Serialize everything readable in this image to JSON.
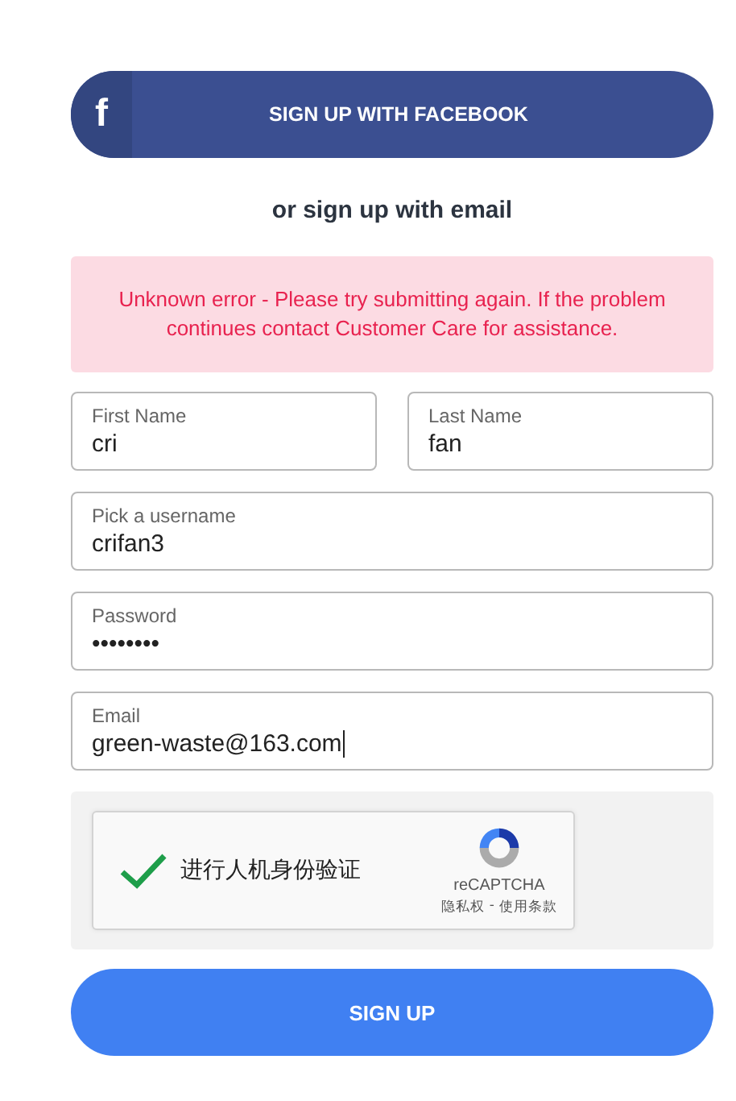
{
  "facebook_button": {
    "icon_letter": "f",
    "label": "SIGN UP WITH FACEBOOK"
  },
  "divider_text": "or sign up with email",
  "error_message": "Unknown error - Please try submitting again. If the problem continues contact Customer Care for assistance.",
  "fields": [
    {
      "label": "First Name",
      "value": "cri",
      "kind": "half",
      "focused": false
    },
    {
      "label": "Last Name",
      "value": "fan",
      "kind": "half",
      "focused": false
    },
    {
      "label": "Pick a username",
      "value": "crifan3",
      "kind": "full",
      "focused": false
    },
    {
      "label": "Password",
      "value": "••••••••",
      "kind": "full",
      "focused": false
    },
    {
      "label": "Email",
      "value": "green-waste@163.com",
      "kind": "full",
      "focused": true
    }
  ],
  "captcha": {
    "checked": true,
    "label": "进行人机身份验证",
    "brand": "reCAPTCHA",
    "links": [
      "隐私权",
      "-",
      "使用条款"
    ]
  },
  "submit_button": "SIGN UP"
}
